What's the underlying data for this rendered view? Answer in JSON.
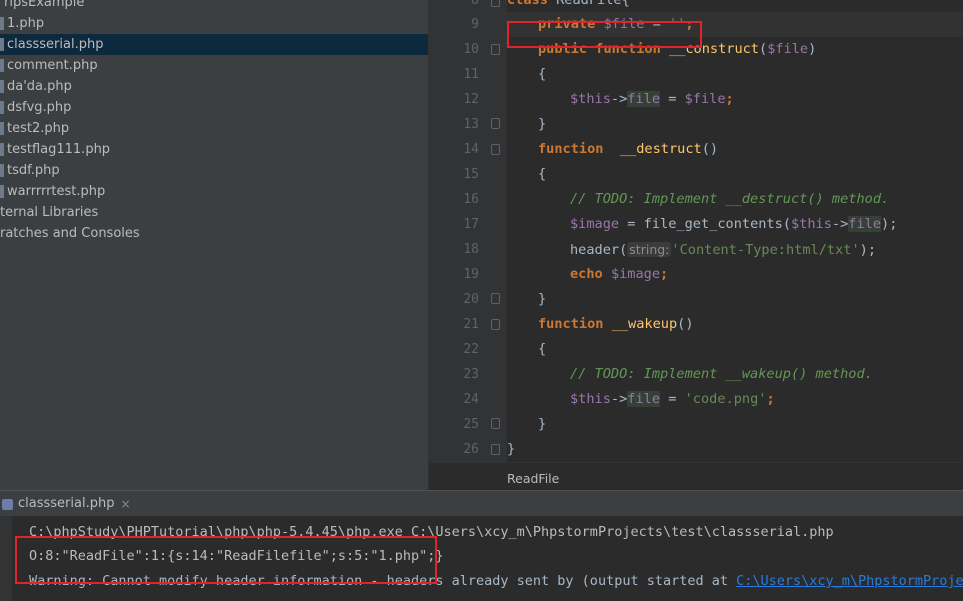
{
  "project_tree": {
    "root_label": "ripsExample",
    "items": [
      {
        "label": "1.php"
      },
      {
        "label": "classserial.php",
        "selected": true
      },
      {
        "label": "comment.php"
      },
      {
        "label": "da'da.php"
      },
      {
        "label": "dsfvg.php"
      },
      {
        "label": "test2.php"
      },
      {
        "label": "testflag111.php"
      },
      {
        "label": "tsdf.php"
      },
      {
        "label": "warrrrrtest.php"
      }
    ],
    "external_libraries": "ternal Libraries",
    "scratches": "ratches and Consoles"
  },
  "editor": {
    "line_numbers": [
      "8",
      "9",
      "10",
      "11",
      "12",
      "13",
      "14",
      "15",
      "16",
      "17",
      "18",
      "19",
      "20",
      "21",
      "22",
      "23",
      "24",
      "25",
      "26"
    ],
    "lines": {
      "l8_kw": "class",
      "l8_name": "ReadFile{",
      "l9_kw": "private",
      "l9_var": "$file",
      "l9_rest": " = ",
      "l9_str": "''",
      "l9_end": ";",
      "l10_kw1": "public",
      "l10_kw2": "function",
      "l10_fn": "__construct",
      "l10_open": "(",
      "l10_var": "$file",
      "l10_close": ")",
      "l11": "{",
      "l12_this": "$this",
      "l12_arrow": "->",
      "l12_prop": "file",
      "l12_eq": " = ",
      "l12_var": "$file",
      "l12_end": ";",
      "l13": "}",
      "l14_kw": "function",
      "l14_fn": "__destruct",
      "l14_paren": "()",
      "l15": "{",
      "l16_cmt": "// TODO: Implement __destruct() method.",
      "l17_var": "$image",
      "l17_eq": " = ",
      "l17_fn": "file_get_contents",
      "l17_open": "(",
      "l17_this": "$this",
      "l17_arrow": "->",
      "l17_prop": "file",
      "l17_close": ");",
      "l18_fn": "header",
      "l18_open": "(",
      "l18_hint": "string:",
      "l18_str": "'Content-Type:html/txt'",
      "l18_close": ");",
      "l19_kw": "echo",
      "l19_var": "$image",
      "l19_end": ";",
      "l20": "}",
      "l21_kw": "function",
      "l21_fn": "__wakeup",
      "l21_paren": "()",
      "l22": "{",
      "l23_cmt": "// TODO: Implement __wakeup() method.",
      "l24_this": "$this",
      "l24_arrow": "->",
      "l24_prop": "file",
      "l24_eq": " = ",
      "l24_str": "'code.png'",
      "l24_end": ";",
      "l25": "}",
      "l26": "}"
    },
    "breadcrumb": "ReadFile"
  },
  "run_panel": {
    "tab_label": "classserial.php",
    "close_glyph": "×",
    "command": "C:\\phpStudy\\PHPTutorial\\php\\php-5.4.45\\php.exe C:\\Users\\xcy_m\\PhpstormProjects\\test\\classserial.php",
    "output": "O:8:\"ReadFile\":1:{s:14:\"ReadFilefile\";s:5:\"1.php\";}",
    "warning_text": "Warning: Cannot modify header information - headers already sent by (output started at ",
    "warning_link": "C:\\Users\\xcy_m\\PhpstormProject"
  },
  "colors": {
    "annotation_red": "#e0242c",
    "selection": "#0d293e",
    "keyword": "#cc7832",
    "string": "#6a8759",
    "variable": "#9876aa",
    "comment": "#629755",
    "function": "#ffc66d"
  }
}
